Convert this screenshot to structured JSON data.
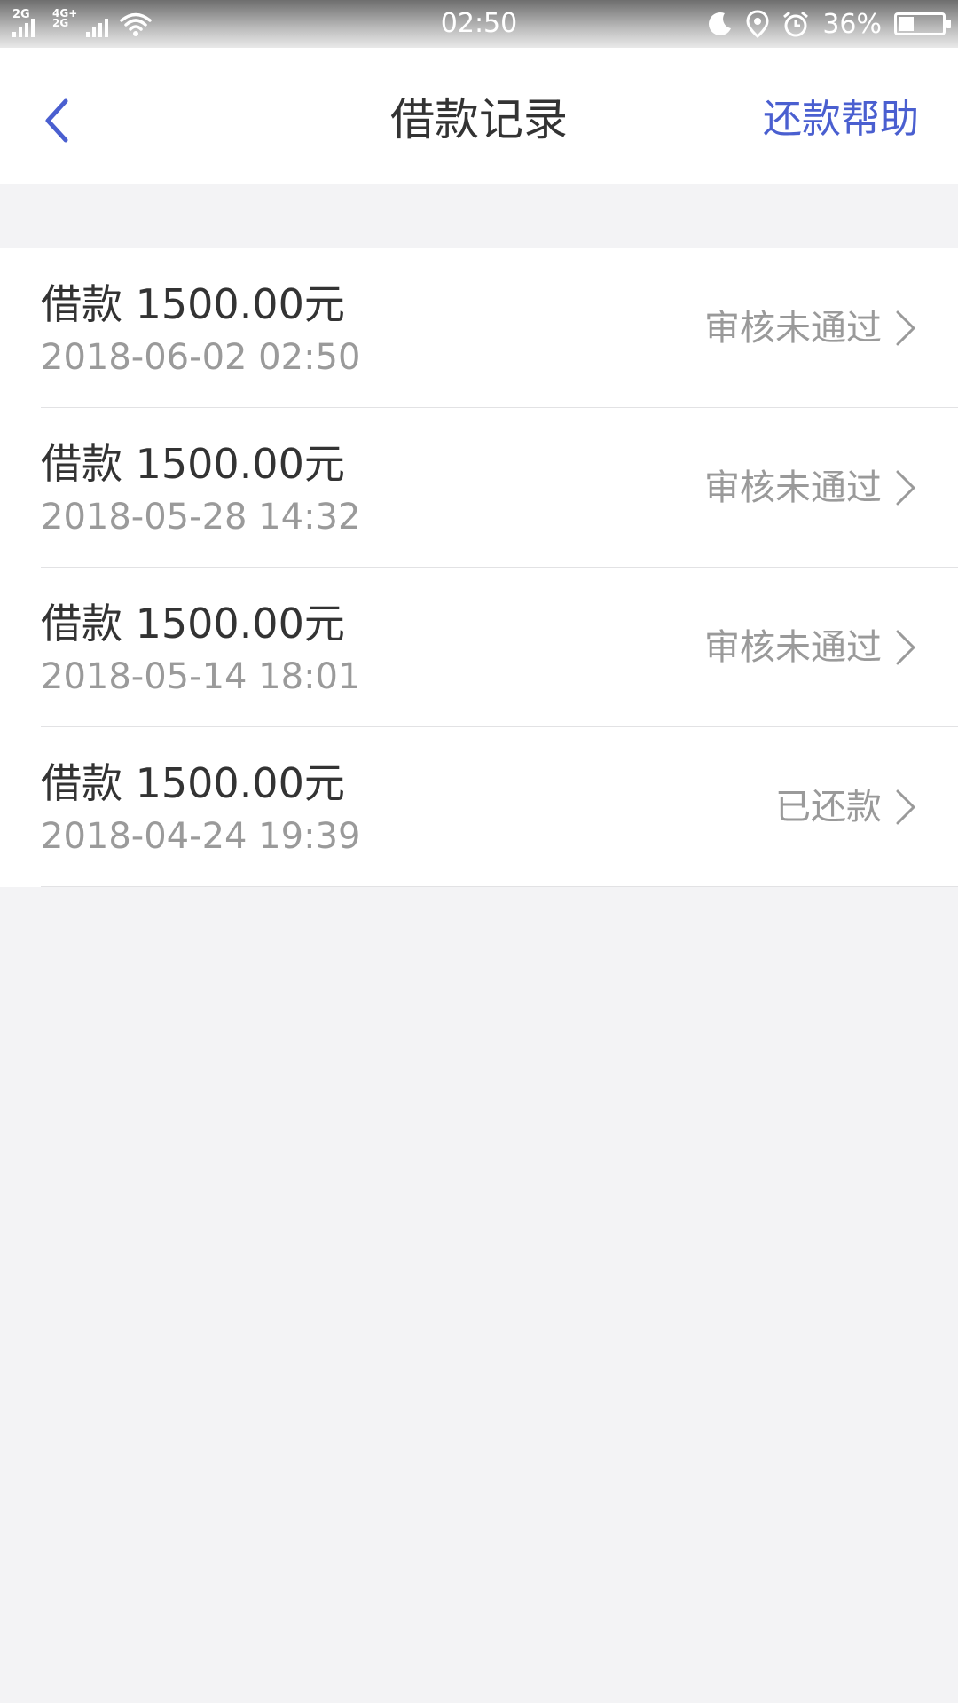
{
  "status_bar": {
    "time": "02:50",
    "sim1_tag": "2G",
    "sim2_tag": "4G+\n2G",
    "battery_text": "36%",
    "battery_level": 0.36,
    "icons": [
      "signal-icon",
      "wifi-icon",
      "moon-icon",
      "location-icon",
      "alarm-icon",
      "battery-icon"
    ]
  },
  "nav": {
    "title": "借款记录",
    "help_label": "还款帮助",
    "back_icon": "chevron-left-icon"
  },
  "colors": {
    "accent": "#4a5fd0",
    "background": "#f3f3f5",
    "text_primary": "#333333",
    "text_secondary": "#9a9a9a"
  },
  "records": [
    {
      "amount": "借款 1500.00元",
      "date": "2018-06-02 02:50",
      "status": "审核未通过"
    },
    {
      "amount": "借款 1500.00元",
      "date": "2018-05-28 14:32",
      "status": "审核未通过"
    },
    {
      "amount": "借款 1500.00元",
      "date": "2018-05-14 18:01",
      "status": "审核未通过"
    },
    {
      "amount": "借款 1500.00元",
      "date": "2018-04-24 19:39",
      "status": "已还款"
    }
  ]
}
